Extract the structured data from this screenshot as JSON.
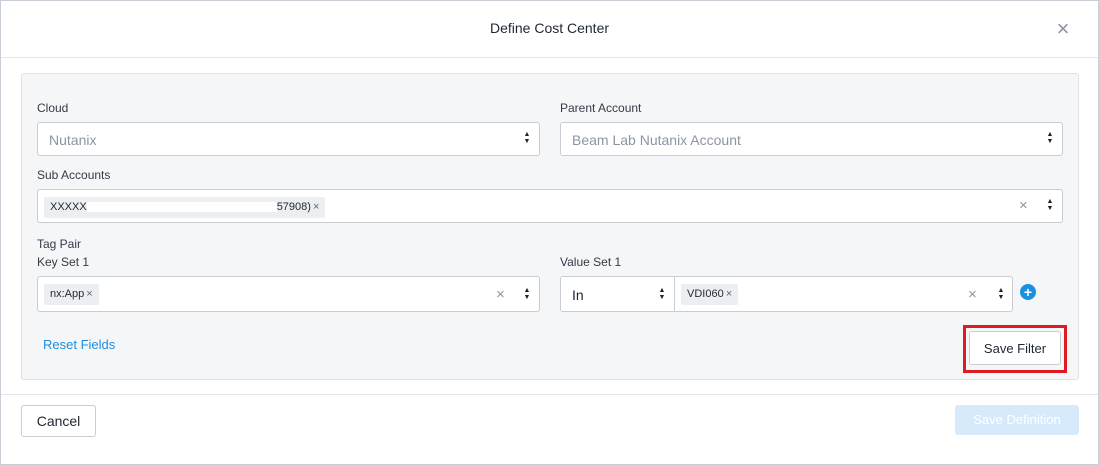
{
  "modal": {
    "title": "Define Cost Center",
    "close_icon": "close-icon"
  },
  "form": {
    "cloud": {
      "label": "Cloud",
      "value": "Nutanix"
    },
    "parent_account": {
      "label": "Parent Account",
      "value": "Beam Lab Nutanix Account"
    },
    "sub_accounts": {
      "label": "Sub Accounts",
      "chip_prefix": "XXXXX",
      "chip_suffix": "57908)",
      "chip_remove": "×"
    },
    "tag_pair": {
      "label": "Tag Pair",
      "key_set_label": "Key Set 1",
      "key_chip": "nx:App",
      "value_set_label": "Value Set 1",
      "operator": "In",
      "value_chip": "VDI060"
    },
    "reset_label": "Reset Fields",
    "save_filter_label": "Save Filter"
  },
  "footer": {
    "cancel_label": "Cancel",
    "save_definition_label": "Save Definition"
  },
  "colors": {
    "accent": "#1b8fe0",
    "highlight": "#e01b22",
    "disabled_button": "#d7eafb"
  }
}
